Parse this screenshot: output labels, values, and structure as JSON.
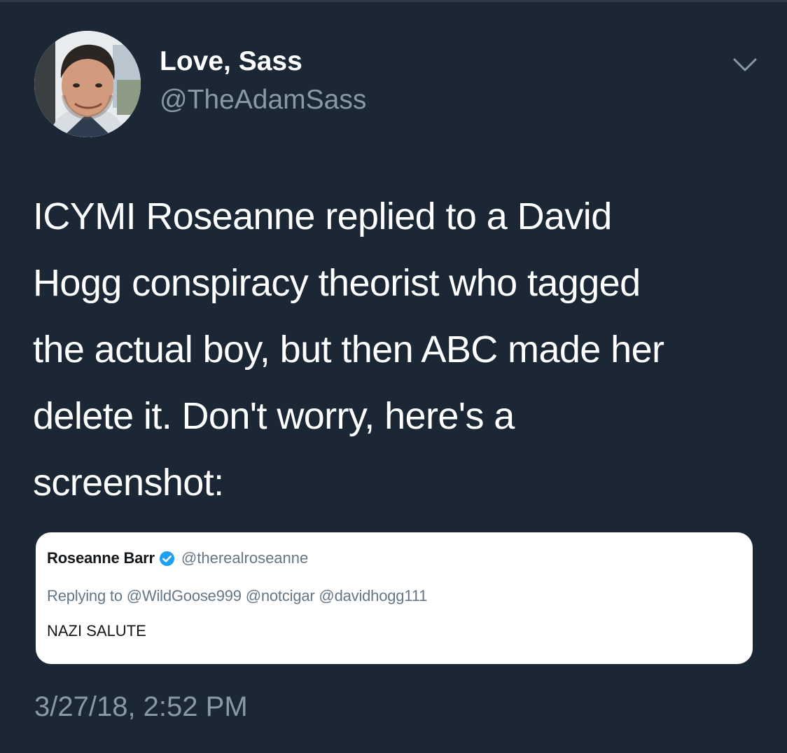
{
  "tweet": {
    "display_name": "Love, Sass",
    "handle": "@TheAdamSass",
    "text_lines": [
      "ICYMI Roseanne replied to a David",
      "Hogg conspiracy theorist who tagged",
      "the actual boy, but then ABC made her",
      "delete it. Don't worry, here's a",
      "screenshot:"
    ],
    "timestamp": "3/27/18, 2:52 PM",
    "menu_icon": "chevron-down-icon"
  },
  "embedded_screenshot": {
    "name": "Roseanne Barr",
    "handle": "@therealroseanne",
    "replying_to": "Replying to @WildGoose999 @notcigar @davidhogg111",
    "body": "NAZI SALUTE",
    "badge_icon": "verified-badge-icon"
  },
  "colors": {
    "background": "#1b2735",
    "primary_text": "#ffffff",
    "secondary_text": "#8899a6",
    "card_background": "#ffffff",
    "verified_blue": "#1da1f2"
  }
}
